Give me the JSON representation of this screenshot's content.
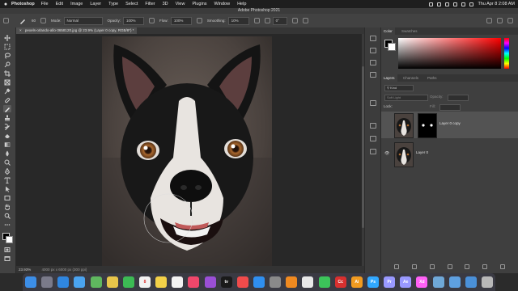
{
  "menubar": {
    "app_name": "Photoshop",
    "items": [
      "File",
      "Edit",
      "Image",
      "Layer",
      "Type",
      "Select",
      "Filter",
      "3D",
      "View",
      "Plugins",
      "Window",
      "Help"
    ],
    "clock": "Thu Apr 8  2:08 AM"
  },
  "window": {
    "title": "Adobe Photoshop 2021"
  },
  "options": {
    "brush_size": "60",
    "mode_label": "Mode:",
    "mode_value": "Normal",
    "opacity_label": "Opacity:",
    "opacity_value": "100%",
    "flow_label": "Flow:",
    "flow_value": "100%",
    "smoothing_label": "Smoothing:",
    "smoothing_value": "10%",
    "angle_value": "0°"
  },
  "document": {
    "tab_label": "pexels-orlando-allo-3658120.jpg @ 23.9% (Layer 0 copy, RGB/8*) *",
    "zoom": "23.93%",
    "dimensions": "4000 px x 6000 px (300 ppi)"
  },
  "color_panel": {
    "tabs": [
      "Color",
      "Swatches"
    ]
  },
  "layers_panel": {
    "tabs": [
      "Layers",
      "Channels",
      "Paths"
    ],
    "filter_label": "Kind",
    "blend_mode": "Soft Light",
    "opacity_label": "Opacity:",
    "lock_label": "Lock:",
    "fill_label": "Fill:",
    "layers": [
      {
        "name": "Layer 0 copy",
        "selected": true,
        "visible": false,
        "has_mask": true
      },
      {
        "name": "Layer 0",
        "selected": false,
        "visible": true,
        "has_mask": false
      }
    ]
  },
  "dock": {
    "apps": [
      {
        "name": "finder",
        "label": "",
        "color": "#3c8ee8"
      },
      {
        "name": "launchpad",
        "label": "",
        "color": "#7a7a8a"
      },
      {
        "name": "safari",
        "label": "",
        "color": "#2f86e0"
      },
      {
        "name": "mail",
        "label": "",
        "color": "#4aa3f0"
      },
      {
        "name": "maps",
        "label": "",
        "color": "#5fb75f"
      },
      {
        "name": "photos",
        "label": "",
        "color": "#e8c54a"
      },
      {
        "name": "facetime",
        "label": "",
        "color": "#3cba54"
      },
      {
        "name": "calendar",
        "label": "8",
        "color": "#f2f2f2"
      },
      {
        "name": "notes",
        "label": "",
        "color": "#f2d048"
      },
      {
        "name": "reminders",
        "label": "",
        "color": "#f2f2f2"
      },
      {
        "name": "music",
        "label": "",
        "color": "#f0476b"
      },
      {
        "name": "podcasts",
        "label": "",
        "color": "#9a4fd6"
      },
      {
        "name": "apple-tv",
        "label": "tv",
        "color": "#1a1a1a"
      },
      {
        "name": "news",
        "label": "",
        "color": "#f04b4b"
      },
      {
        "name": "app-store",
        "label": "",
        "color": "#2f8ff0"
      },
      {
        "name": "system-preferences",
        "label": "",
        "color": "#8a8a8a"
      },
      {
        "name": "vlc",
        "label": "",
        "color": "#f08a20"
      },
      {
        "name": "chrome",
        "label": "",
        "color": "#e8e8e8"
      },
      {
        "name": "messages",
        "label": "",
        "color": "#3cc45a"
      },
      {
        "name": "adobe-cc",
        "label": "Cc",
        "color": "#d8302f"
      },
      {
        "name": "illustrator",
        "label": "Ai",
        "color": "#f09a20"
      },
      {
        "name": "photoshop",
        "label": "Ps",
        "color": "#31a8ff"
      },
      {
        "name": "premiere",
        "label": "Pr",
        "color": "#9999ff"
      },
      {
        "name": "after-effects",
        "label": "Ae",
        "color": "#9999ff"
      },
      {
        "name": "adobe-xd",
        "label": "Xd",
        "color": "#ff61f6"
      },
      {
        "name": "preview",
        "label": "",
        "color": "#6fa8d8"
      },
      {
        "name": "folder",
        "label": "",
        "color": "#5ea0e0"
      },
      {
        "name": "downloads",
        "label": "",
        "color": "#4a90d9"
      },
      {
        "name": "trash",
        "label": "",
        "color": "#b8b8b8"
      }
    ]
  }
}
